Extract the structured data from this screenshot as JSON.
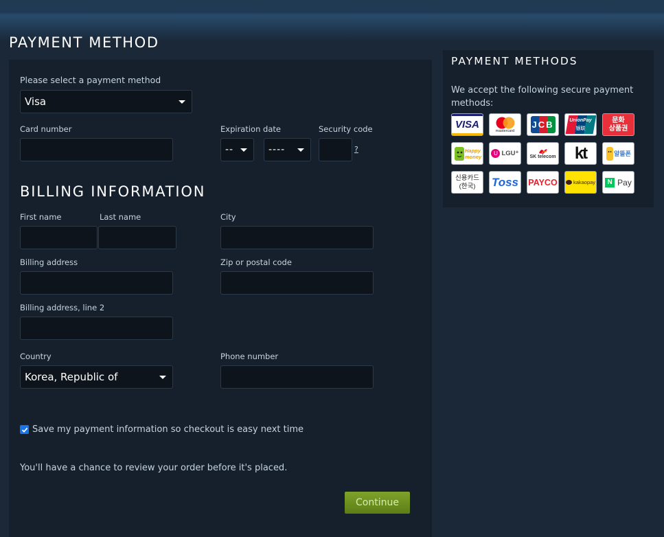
{
  "page_title": "PAYMENT METHOD",
  "payment": {
    "select_label": "Please select a payment method",
    "selected_method": "Visa",
    "card_number_label": "Card number",
    "expiration_label": "Expiration date",
    "exp_month": "--",
    "exp_year": "----",
    "security_label": "Security code",
    "security_help": "?"
  },
  "billing": {
    "title": "BILLING INFORMATION",
    "first_name_label": "First name",
    "last_name_label": "Last name",
    "city_label": "City",
    "address_label": "Billing address",
    "zip_label": "Zip or postal code",
    "address2_label": "Billing address, line 2",
    "country_label": "Country",
    "country_value": "Korea, Republic of",
    "phone_label": "Phone number"
  },
  "save_info": {
    "checked": true,
    "label": "Save my payment information so checkout is easy next time"
  },
  "review_note": "You'll have a chance to review your order before it's placed.",
  "continue_label": "Continue",
  "sidebar": {
    "title": "PAYMENT METHODS",
    "text": "We accept the following secure payment methods:",
    "logos": {
      "visa": "VISA",
      "mastercard": "mastercard",
      "jcb": "JCB",
      "unionpay": "UnionPay",
      "unionpay_cn": "银联",
      "culture_1": "문화",
      "culture_2": "상품권",
      "happymoney_1": "Happy",
      "happymoney_2": "money",
      "lgu": "LGU⁺",
      "sk": "SK telecom",
      "kt": "kt",
      "alddeul": "알뜰폰",
      "korea_card_1": "신용카드",
      "korea_card_2": "(한국)",
      "toss": "Toss",
      "payco": "PAYCO",
      "kakaopay": "kakaopay",
      "naverpay_n": "N",
      "naverpay": "Pay"
    }
  }
}
